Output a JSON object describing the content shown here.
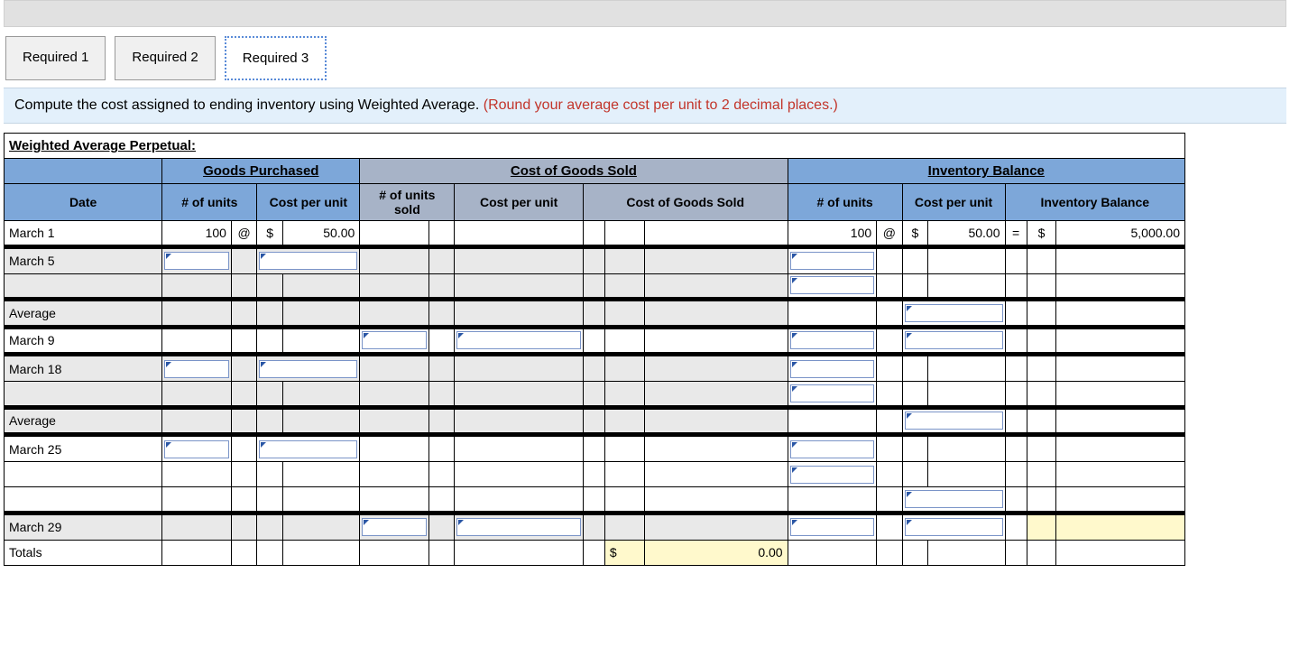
{
  "tabs": {
    "required1": "Required 1",
    "required2": "Required 2",
    "required3": "Required 3"
  },
  "instruction": {
    "main": "Compute the cost assigned to ending inventory using Weighted Average. ",
    "note": "(Round your average cost per unit to 2 decimal places.)"
  },
  "tableTitle": "Weighted Average Perpetual:",
  "groupHeaders": {
    "goodsPurchased": "Goods Purchased",
    "cogs": "Cost of Goods Sold",
    "inventoryBalance": "Inventory Balance"
  },
  "colHeaders": {
    "date": "Date",
    "numUnits": "# of units",
    "costPerUnit": "Cost per unit",
    "numUnitsSold": "# of units sold",
    "costPerUnit2": "Cost per unit",
    "cogs": "Cost of Goods Sold",
    "numUnits2": "# of units",
    "costPerUnit3": "Cost per unit",
    "inventoryBalance": "Inventory Balance"
  },
  "rows": {
    "march1": {
      "date": "March 1",
      "gp_units": "100",
      "gp_at": "@",
      "gp_sym": "$",
      "gp_cpu": "50.00",
      "ib_units": "100",
      "ib_at": "@",
      "ib_sym": "$",
      "ib_cpu": "50.00",
      "ib_eq": "=",
      "ib_sym2": "$",
      "ib_bal": "5,000.00"
    },
    "march5": {
      "date": "March 5"
    },
    "blank1": {
      "date": ""
    },
    "average1": {
      "date": "Average"
    },
    "march9": {
      "date": "March 9"
    },
    "march18": {
      "date": "March 18"
    },
    "blank2": {
      "date": ""
    },
    "average2": {
      "date": "Average"
    },
    "march25": {
      "date": "March 25"
    },
    "blank3": {
      "date": ""
    },
    "blank4": {
      "date": ""
    },
    "march29": {
      "date": "March 29"
    },
    "totals": {
      "date": "Totals",
      "cogs_sym": "$",
      "cogs_val": "0.00"
    }
  }
}
